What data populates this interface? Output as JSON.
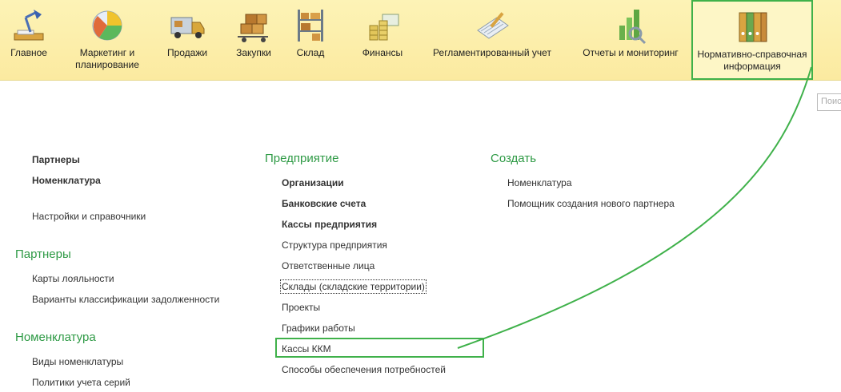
{
  "toolbar": {
    "items": [
      {
        "label": "Главное",
        "icon": "desk-lamp-icon"
      },
      {
        "label": "Маркетинг и\nпланирование",
        "icon": "pie-chart-icon"
      },
      {
        "label": "Продажи",
        "icon": "truck-icon"
      },
      {
        "label": "Закупки",
        "icon": "boxes-cart-icon"
      },
      {
        "label": "Склад",
        "icon": "shelves-icon"
      },
      {
        "label": "Финансы",
        "icon": "coin-stacks-icon"
      },
      {
        "label": "Регламентированный учет",
        "icon": "notebook-pen-icon"
      },
      {
        "label": "Отчеты и мониторинг",
        "icon": "bar-chart-magnifier-icon"
      },
      {
        "label": "Нормативно-справочная\nинформация",
        "icon": "binders-icon",
        "active": true
      }
    ]
  },
  "search": {
    "placeholder": "Поиск"
  },
  "col1": {
    "top_links": [
      "Партнеры",
      "Номенклатура",
      "Настройки и справочники"
    ],
    "partners_title": "Партнеры",
    "partners_links": [
      "Карты лояльности",
      "Варианты классификации задолженности"
    ],
    "nomenclature_title": "Номенклатура",
    "nomenclature_links": [
      "Виды номенклатуры",
      "Политики учета серий"
    ]
  },
  "col2": {
    "title": "Предприятие",
    "links": [
      "Организации",
      "Банковские счета",
      "Кассы предприятия",
      "Структура предприятия",
      "Ответственные лица",
      "Склады (складские территории)",
      "Проекты",
      "Графики работы",
      "Кассы ККМ",
      "Способы обеспечения потребностей"
    ]
  },
  "col3": {
    "title": "Создать",
    "links": [
      "Номенклатура",
      "Помощник создания нового партнера"
    ]
  },
  "colors": {
    "accent": "#2e9a45",
    "annotation": "#3fb14a",
    "toolbar_bg": "#fbeaa0"
  }
}
